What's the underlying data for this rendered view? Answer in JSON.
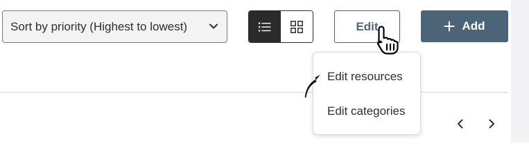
{
  "toolbar": {
    "sort_select": {
      "value": "Sort by priority (Highest to lowest)"
    },
    "view_toggle": {
      "active": "list"
    },
    "edit_label": "Edit",
    "add_label": "Add"
  },
  "edit_menu": {
    "items": [
      {
        "label": "Edit resources"
      },
      {
        "label": "Edit categories"
      }
    ]
  },
  "icons": {
    "sort_chevron": "chevron-down-icon",
    "list_view": "list-view-icon",
    "grid_view": "grid-view-icon",
    "add": "plus-icon",
    "prev": "chevron-left-icon",
    "next": "chevron-right-icon"
  },
  "colors": {
    "primary": "#4b6477",
    "toggle_active": "#2b2b2b",
    "select_background": "#f3f3f3"
  }
}
